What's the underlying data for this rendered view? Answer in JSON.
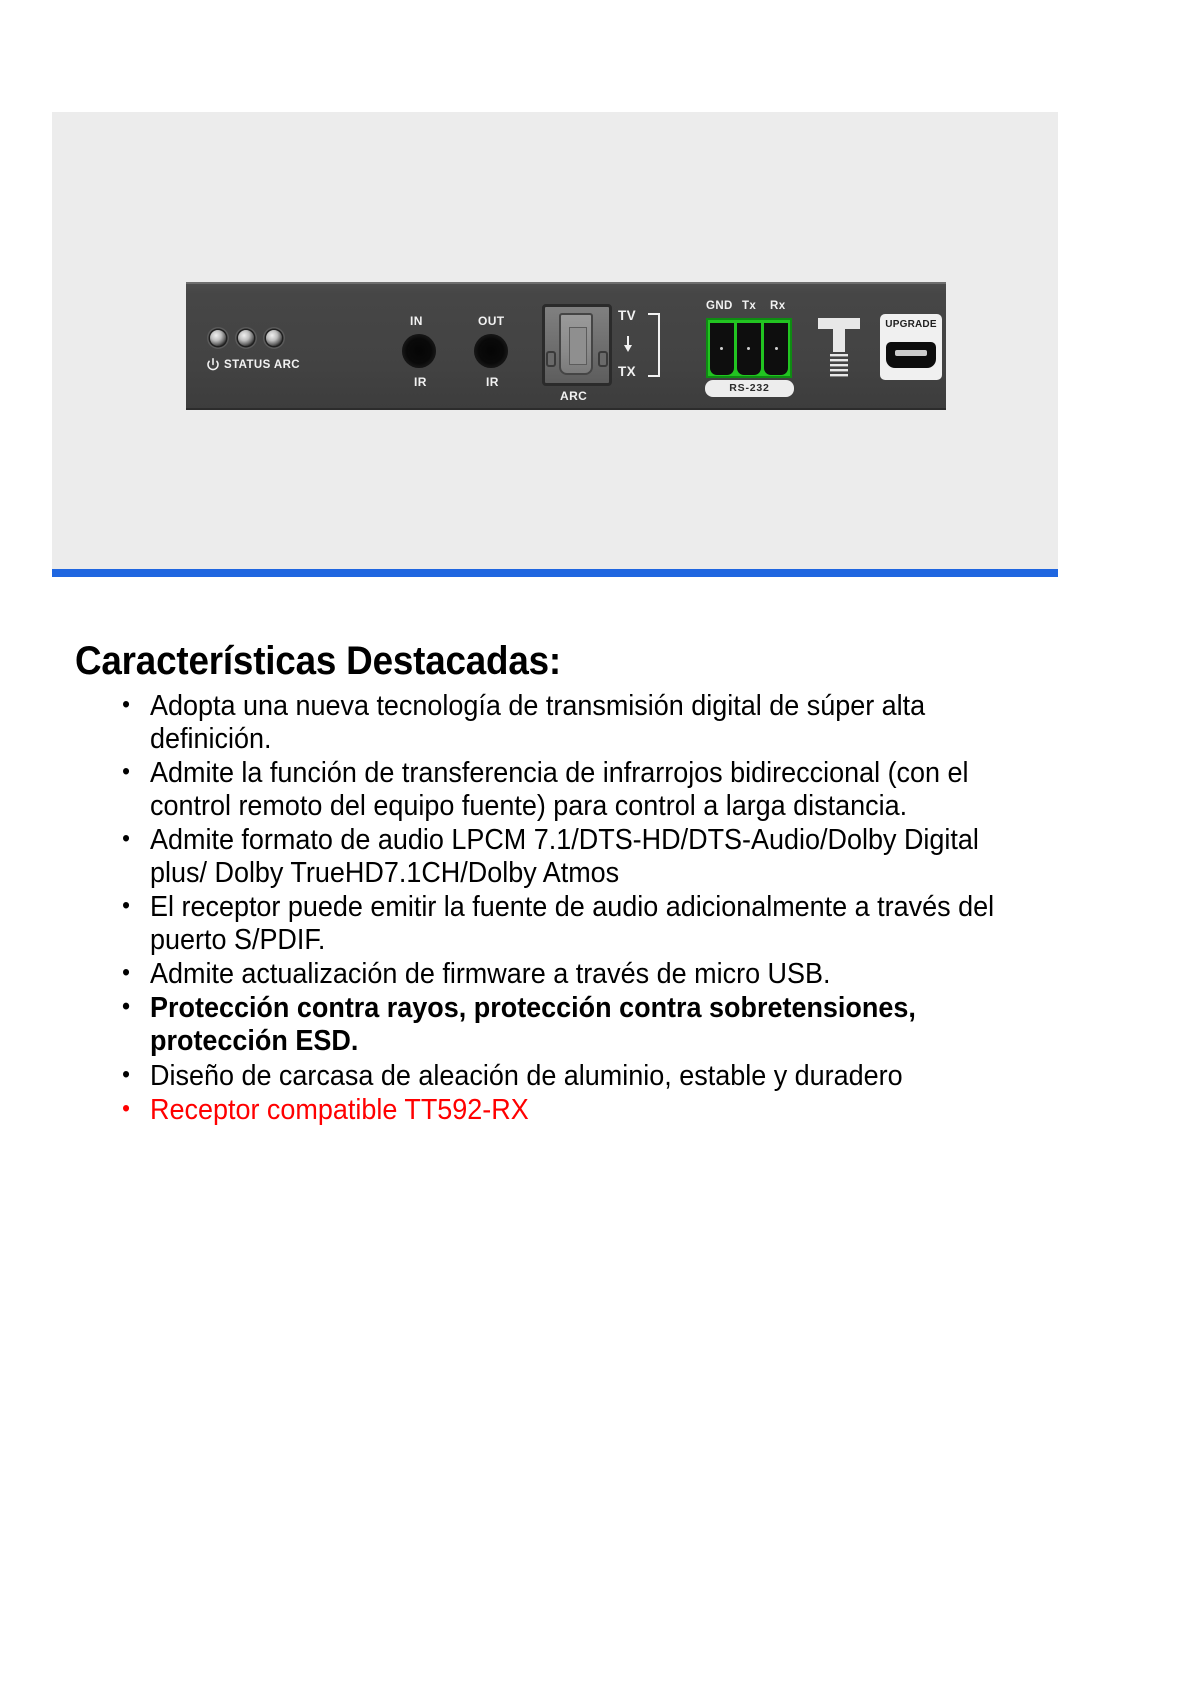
{
  "theme": {
    "accent_bar_color": "#1f66e0",
    "image_bg_color": "#ececec",
    "panel_color": "#454545",
    "terminal_green": "#22c421",
    "highlight_red": "#ff0000"
  },
  "product_panel": {
    "alt_name": "rear-panel-of-hdmi-extender-transmitter",
    "leds": [
      {
        "name": "power-led"
      },
      {
        "name": "status-led"
      },
      {
        "name": "arc-led"
      }
    ],
    "power_symbol": "power-icon",
    "status_arc_label": "STATUS ARC",
    "ir_in_label": "IN",
    "ir_out_label": "OUT",
    "ir_in_sub_label": "IR",
    "ir_out_sub_label": "IR",
    "optical_port_label": "ARC",
    "tv_label": "TV",
    "tx_label": "TX",
    "direction_arrow": "arrow-down-icon",
    "rs232_pins": [
      "GND",
      "Tx",
      "Rx"
    ],
    "rs232_tag": "RS-232",
    "ground_terminal": "ground-screw-icon",
    "upgrade_label": "UPGRADE",
    "upgrade_port": "micro-usb-icon"
  },
  "content": {
    "heading": "Características Destacadas:",
    "features": [
      {
        "text": "Adopta una nueva tecnología de transmisión digital de súper alta definición.",
        "style": "normal"
      },
      {
        "text": "Admite la función de transferencia de infrarrojos bidireccional (con el control remoto del equipo fuente) para control a larga distancia.",
        "style": "normal"
      },
      {
        "text": "Admite formato de audio LPCM 7.1/DTS-HD/DTS-Audio/Dolby Digital plus/ Dolby TrueHD7.1CH/Dolby Atmos",
        "style": "normal"
      },
      {
        "text": "El receptor puede emitir la fuente de audio adicionalmente a través del puerto S/PDIF.",
        "style": "normal"
      },
      {
        "text": "Admite actualización de firmware a través de micro USB.",
        "style": "normal"
      },
      {
        "text": "Protección contra rayos, protección contra sobretensiones, protección ESD.",
        "style": "bold"
      },
      {
        "text": "Diseño de carcasa de aleación de aluminio, estable y duradero",
        "style": "normal"
      },
      {
        "text": "Receptor compatible TT592-RX",
        "style": "red"
      }
    ]
  }
}
